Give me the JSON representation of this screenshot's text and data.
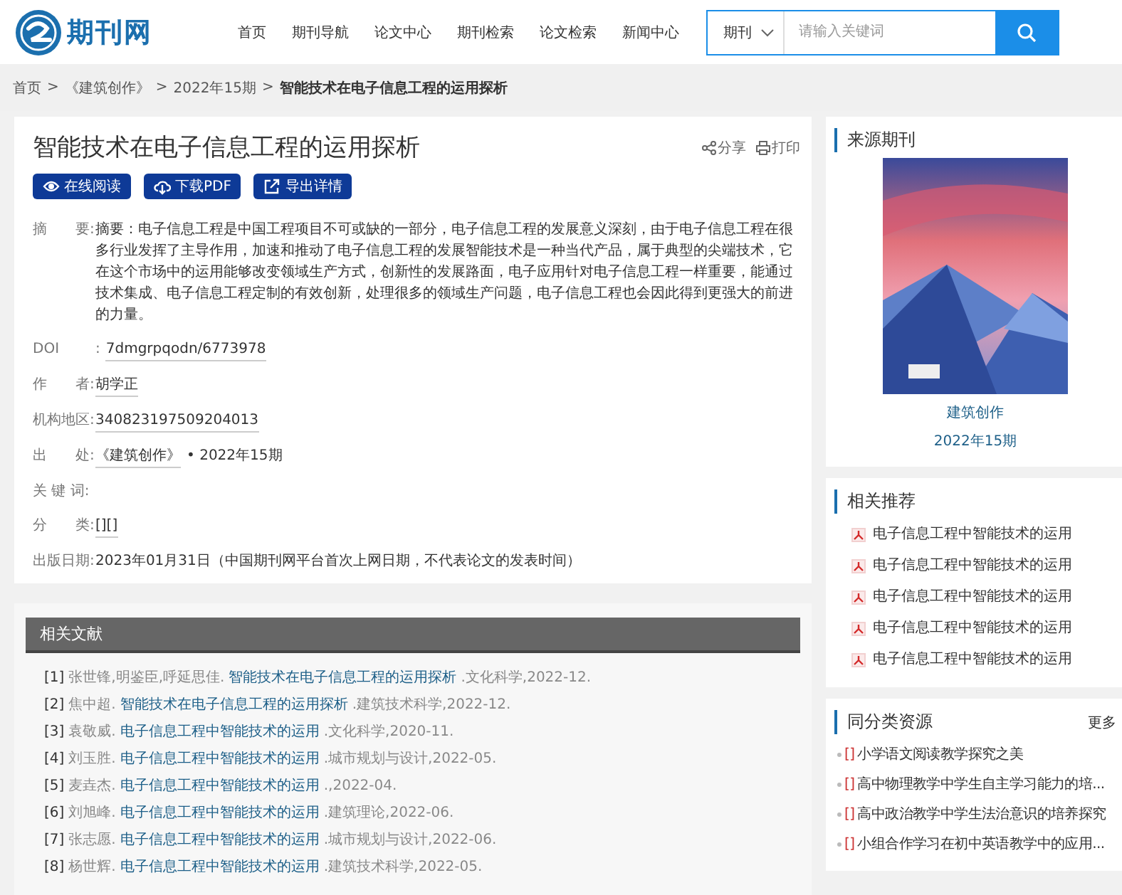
{
  "header": {
    "logo_text": "期刊网",
    "nav": [
      {
        "label": "首页",
        "selected": false
      },
      {
        "label": "期刊导航",
        "selected": false
      },
      {
        "label": "论文中心",
        "selected": false
      },
      {
        "label": "期刊检索",
        "selected": false
      },
      {
        "label": "论文检索",
        "selected": false
      },
      {
        "label": "新闻中心",
        "selected": false
      }
    ],
    "search": {
      "scope": "期刊",
      "placeholder": "请输入关键词"
    }
  },
  "breadcrumb": [
    {
      "label": "首页",
      "current": false
    },
    {
      "sep": ">"
    },
    {
      "label": "《建筑创作》",
      "current": false
    },
    {
      "sep": ">"
    },
    {
      "label": "2022年15期",
      "current": false
    },
    {
      "sep": ">"
    },
    {
      "label": "智能技术在电子信息工程的运用探析",
      "current": true
    }
  ],
  "article": {
    "title": "智能技术在电子信息工程的运用探析",
    "share": "分享",
    "print": "打印",
    "buttons": [
      {
        "kind": "read",
        "label": "在线阅读"
      },
      {
        "kind": "download",
        "label": "下载PDF"
      },
      {
        "kind": "export",
        "label": "导出详情"
      }
    ],
    "fields": [
      {
        "label": "摘　　要:",
        "value": "摘要：电子信息工程是中国工程项目不可或缺的一部分，电子信息工程的发展意义深刻，由于电子信息工程在很多行业发挥了主导作用，加速和推动了电子信息工程的发展智能技术是一种当代产品，属于典型的尖端技术，它在这个市场中的运用能够改变领域生产方式，创新性的发展路面，电子应用针对电子信息工程一样重要，能通过技术集成、电子信息工程定制的有效创新，处理很多的领域生产问题，电子信息工程也会因此得到更强大的前进的力量。",
        "kind": "text"
      },
      {
        "label": "DOI",
        "colon": ":",
        "value": "7dmgrpqodn/6773978",
        "kind": "link"
      },
      {
        "label": "作　　者:",
        "value": "胡学正",
        "kind": "link"
      },
      {
        "label": "机构地区:",
        "value": "340823197509204013",
        "kind": "link"
      },
      {
        "label": "出　　处:",
        "value": "《建筑创作》",
        "extra": "• 2022年15期",
        "kind": "link"
      },
      {
        "label": "关 键 词:"
      },
      {
        "label": "分　　类:",
        "value": "[][]",
        "kind": "link"
      },
      {
        "label": "出版日期:",
        "value": "2023年01月31日（中国期刊网平台首次上网日期，不代表论文的发表时间）",
        "kind": "text"
      }
    ]
  },
  "related_literature": {
    "title": "相关文献",
    "items": [
      {
        "num": "[1]",
        "authors": "张世锋,明鉴臣,呼延思佳.",
        "title": "智能技术在电子信息工程的运用探析",
        "source": ".文化科学,2022-12."
      },
      {
        "num": "[2]",
        "authors": "焦中超.",
        "title": "智能技术在电子信息工程的运用探析",
        "source": ".建筑技术科学,2022-12."
      },
      {
        "num": "[3]",
        "authors": "袁敬威.",
        "title": "电子信息工程中智能技术的运用",
        "source": ".文化科学,2020-11."
      },
      {
        "num": "[4]",
        "authors": "刘玉胜.",
        "title": "电子信息工程中智能技术的运用",
        "source": ".城市规划与设计,2022-05."
      },
      {
        "num": "[5]",
        "authors": "麦垚杰.",
        "title": "电子信息工程中智能技术的运用",
        "source": ".,2022-04."
      },
      {
        "num": "[6]",
        "authors": "刘旭峰.",
        "title": "电子信息工程中智能技术的运用",
        "source": ".建筑理论,2022-06."
      },
      {
        "num": "[7]",
        "authors": "张志愿.",
        "title": "电子信息工程中智能技术的运用",
        "source": ".城市规划与设计,2022-06."
      },
      {
        "num": "[8]",
        "authors": "杨世辉.",
        "title": "电子信息工程中智能技术的运用",
        "source": ".建筑技术科学,2022-05."
      }
    ]
  },
  "source_journal": {
    "title": "来源期刊",
    "name": "建筑创作",
    "issue": "2022年15期"
  },
  "recommendations": {
    "title": "相关推荐",
    "items": [
      "电子信息工程中智能技术的运用",
      "电子信息工程中智能技术的运用",
      "电子信息工程中智能技术的运用",
      "电子信息工程中智能技术的运用",
      "电子信息工程中智能技术的运用"
    ]
  },
  "same_category": {
    "title": "同分类资源",
    "more": "更多",
    "items": [
      {
        "mark": "[]",
        "title": "小学语文阅读教学探究之美"
      },
      {
        "mark": "[]",
        "title": "高中物理教学中学生自主学习能力的培..."
      },
      {
        "mark": "[]",
        "title": "高中政治教学中学生法治意识的培养探究"
      },
      {
        "mark": "[]",
        "title": "小组合作学习在初中英语教学中的应用..."
      }
    ]
  }
}
